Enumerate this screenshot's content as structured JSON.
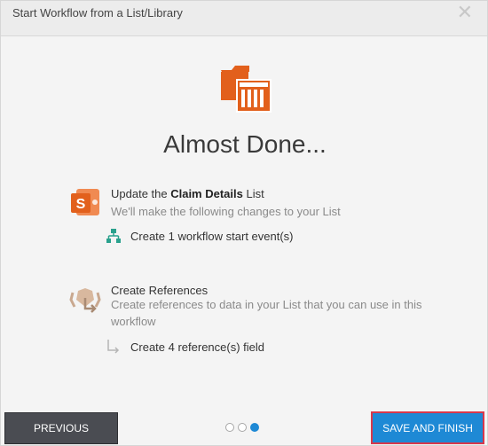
{
  "dialog": {
    "title": "Start Workflow from a List/Library",
    "close_symbol": "✕"
  },
  "hero": {
    "icon": "folder-list-icon",
    "heading": "Almost Done..."
  },
  "steps": [
    {
      "icon": "sharepoint-icon",
      "title_prefix": "Update the ",
      "title_bold": "Claim Details",
      "title_suffix": " List",
      "description": "We'll make the following changes to your List",
      "sub_icon": "workflow-tree-icon",
      "sub_text": "Create 1 workflow start event(s)"
    },
    {
      "icon": "references-icon",
      "title": "Create References",
      "description": "Create references to data in your List that you can use in this workflow",
      "sub_icon": "arrow-return-icon",
      "sub_text": "Create 4 reference(s) field"
    }
  ],
  "footer": {
    "previous_label": "PREVIOUS",
    "save_label": "SAVE AND FINISH",
    "progress": {
      "current": 3,
      "total": 3
    }
  },
  "colors": {
    "accent_orange": "#e2601c",
    "primary_blue": "#1e89d5",
    "highlight_red": "#d8384c",
    "tree_teal": "#2aa18d"
  }
}
